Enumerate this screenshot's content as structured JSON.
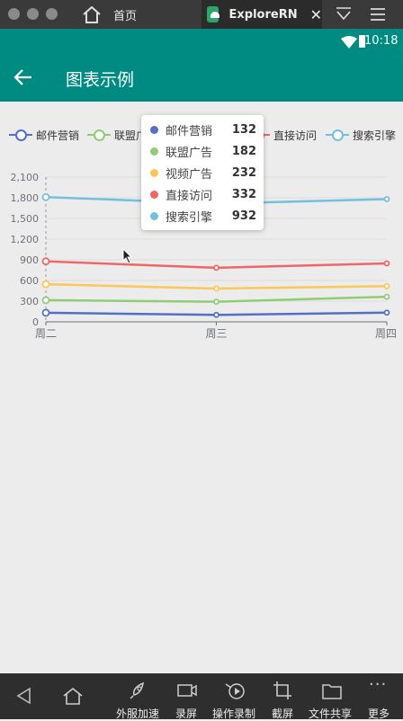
{
  "window": {
    "home_tab_label": "首页",
    "app_tab_label": "ExploreRN"
  },
  "status_bar": {
    "time": "10:18"
  },
  "app_bar": {
    "title": "图表示例"
  },
  "legend": [
    {
      "name": "邮件营销",
      "color": "#5470c6"
    },
    {
      "name": "联盟广告",
      "color": "#91cc75"
    },
    {
      "name": "视频广告",
      "color": "#fac858"
    },
    {
      "name": "直接访问",
      "color": "#ee6666"
    },
    {
      "name": "搜索引擎",
      "color": "#73c0de"
    }
  ],
  "legend_visible_text": [
    "邮件营销",
    "联盟广",
    "直接访问",
    "搜索引擎"
  ],
  "tooltip": {
    "rows": [
      {
        "name": "邮件营销",
        "value": "132",
        "color": "#5470c6"
      },
      {
        "name": "联盟广告",
        "value": "182",
        "color": "#91cc75"
      },
      {
        "name": "视频广告",
        "value": "232",
        "color": "#fac858"
      },
      {
        "name": "直接访问",
        "value": "332",
        "color": "#ee6666"
      },
      {
        "name": "搜索引擎",
        "value": "932",
        "color": "#73c0de"
      }
    ]
  },
  "chart_data": {
    "type": "line",
    "stacked": true,
    "categories": [
      "周二",
      "周三",
      "周四"
    ],
    "ylim": [
      0,
      2100
    ],
    "yticks": [
      0,
      300,
      600,
      900,
      1200,
      1500,
      1800,
      2100
    ],
    "ytick_labels": [
      "0",
      "300",
      "600",
      "900",
      "1,200",
      "1,500",
      "1,800",
      "2,100"
    ],
    "series": [
      {
        "name": "邮件营销",
        "color": "#5470c6",
        "values": [
          132,
          101,
          134
        ]
      },
      {
        "name": "联盟广告",
        "color": "#91cc75",
        "values": [
          314,
          292,
          364
        ]
      },
      {
        "name": "视频广告",
        "color": "#fac858",
        "values": [
          546,
          483,
          518
        ]
      },
      {
        "name": "直接访问",
        "color": "#ee6666",
        "values": [
          878,
          784,
          848
        ]
      },
      {
        "name": "搜索引擎",
        "color": "#73c0de",
        "values": [
          1810,
          1716,
          1780
        ]
      }
    ],
    "legend_position": "top",
    "grid": true
  },
  "bottom_bar": {
    "labels": [
      "外服加速",
      "录屏",
      "操作录制",
      "截屏",
      "文件共享",
      "更多"
    ]
  }
}
